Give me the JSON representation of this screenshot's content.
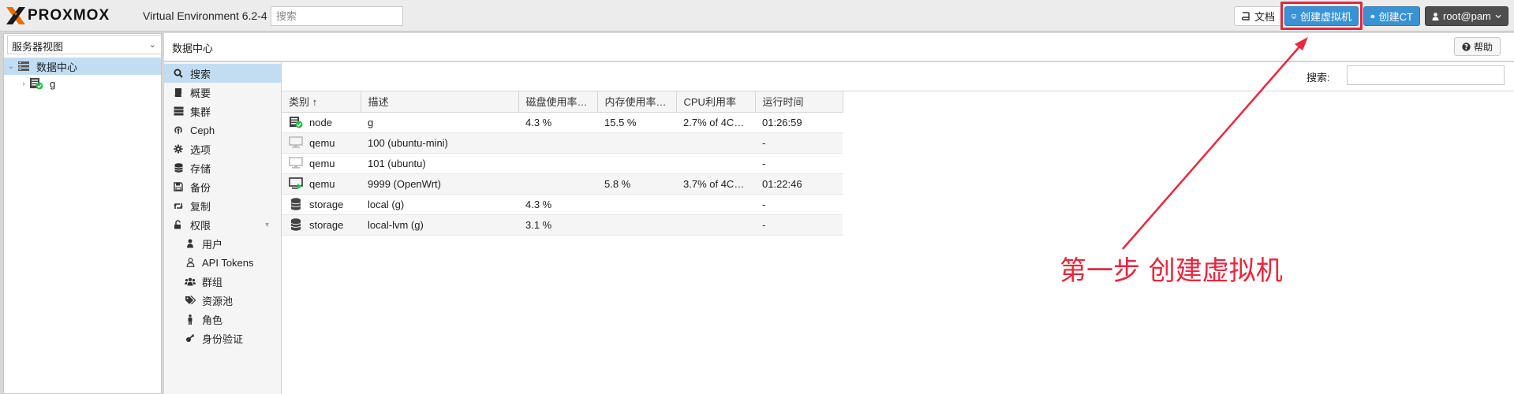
{
  "app": {
    "logo_text": "PROXMOX",
    "version": "Virtual Environment 6.2-4",
    "search_placeholder": "搜索"
  },
  "topbar": {
    "docs_label": "文档",
    "create_vm_label": "创建虚拟机",
    "create_ct_label": "创建CT",
    "user_label": "root@pam"
  },
  "tree": {
    "view_label": "服务器视图",
    "datacenter_label": "数据中心",
    "node_label": "g"
  },
  "main": {
    "title": "数据中心",
    "help_label": "帮助",
    "search_label": "搜索:"
  },
  "nav": {
    "items": [
      {
        "label": "搜索",
        "icon": "search-icon"
      },
      {
        "label": "概要",
        "icon": "book-icon"
      },
      {
        "label": "集群",
        "icon": "server-icon"
      },
      {
        "label": "Ceph",
        "icon": "ceph-icon"
      },
      {
        "label": "选项",
        "icon": "gear-icon"
      },
      {
        "label": "存储",
        "icon": "database-icon"
      },
      {
        "label": "备份",
        "icon": "floppy-icon"
      },
      {
        "label": "复制",
        "icon": "retweet-icon"
      },
      {
        "label": "权限",
        "icon": "unlock-icon"
      },
      {
        "label": "用户",
        "icon": "user-icon"
      },
      {
        "label": "API Tokens",
        "icon": "user-outline-icon"
      },
      {
        "label": "群组",
        "icon": "users-icon"
      },
      {
        "label": "资源池",
        "icon": "tags-icon"
      },
      {
        "label": "角色",
        "icon": "male-icon"
      },
      {
        "label": "身份验证",
        "icon": "key-icon"
      }
    ]
  },
  "grid": {
    "headers": [
      "类别 ↑",
      "描述",
      "磁盘使用率…",
      "内存使用率…",
      "CPU利用率",
      "运行时间"
    ],
    "rows": [
      {
        "type": "node",
        "desc": "g",
        "disk": "4.3 %",
        "mem": "15.5 %",
        "cpu": "2.7% of 4C…",
        "uptime": "01:26:59"
      },
      {
        "type": "qemu",
        "desc": "100 (ubuntu-mini)",
        "disk": "",
        "mem": "",
        "cpu": "",
        "uptime": "-"
      },
      {
        "type": "qemu",
        "desc": "101 (ubuntu)",
        "disk": "",
        "mem": "",
        "cpu": "",
        "uptime": "-"
      },
      {
        "type": "qemu",
        "desc": "9999 (OpenWrt)",
        "disk": "",
        "mem": "5.8 %",
        "cpu": "3.7% of 4C…",
        "uptime": "01:22:46"
      },
      {
        "type": "storage",
        "desc": "local (g)",
        "disk": "4.3 %",
        "mem": "",
        "cpu": "",
        "uptime": "-"
      },
      {
        "type": "storage",
        "desc": "local-lvm (g)",
        "disk": "3.1 %",
        "mem": "",
        "cpu": "",
        "uptime": "-"
      }
    ]
  },
  "annotation": {
    "text": "第一步 创建虚拟机",
    "color": "#e8283c"
  },
  "colors": {
    "accent": "#3892d4",
    "selected": "#c2ddf2",
    "brand_orange": "#e57000",
    "annotation": "#e8283c"
  }
}
